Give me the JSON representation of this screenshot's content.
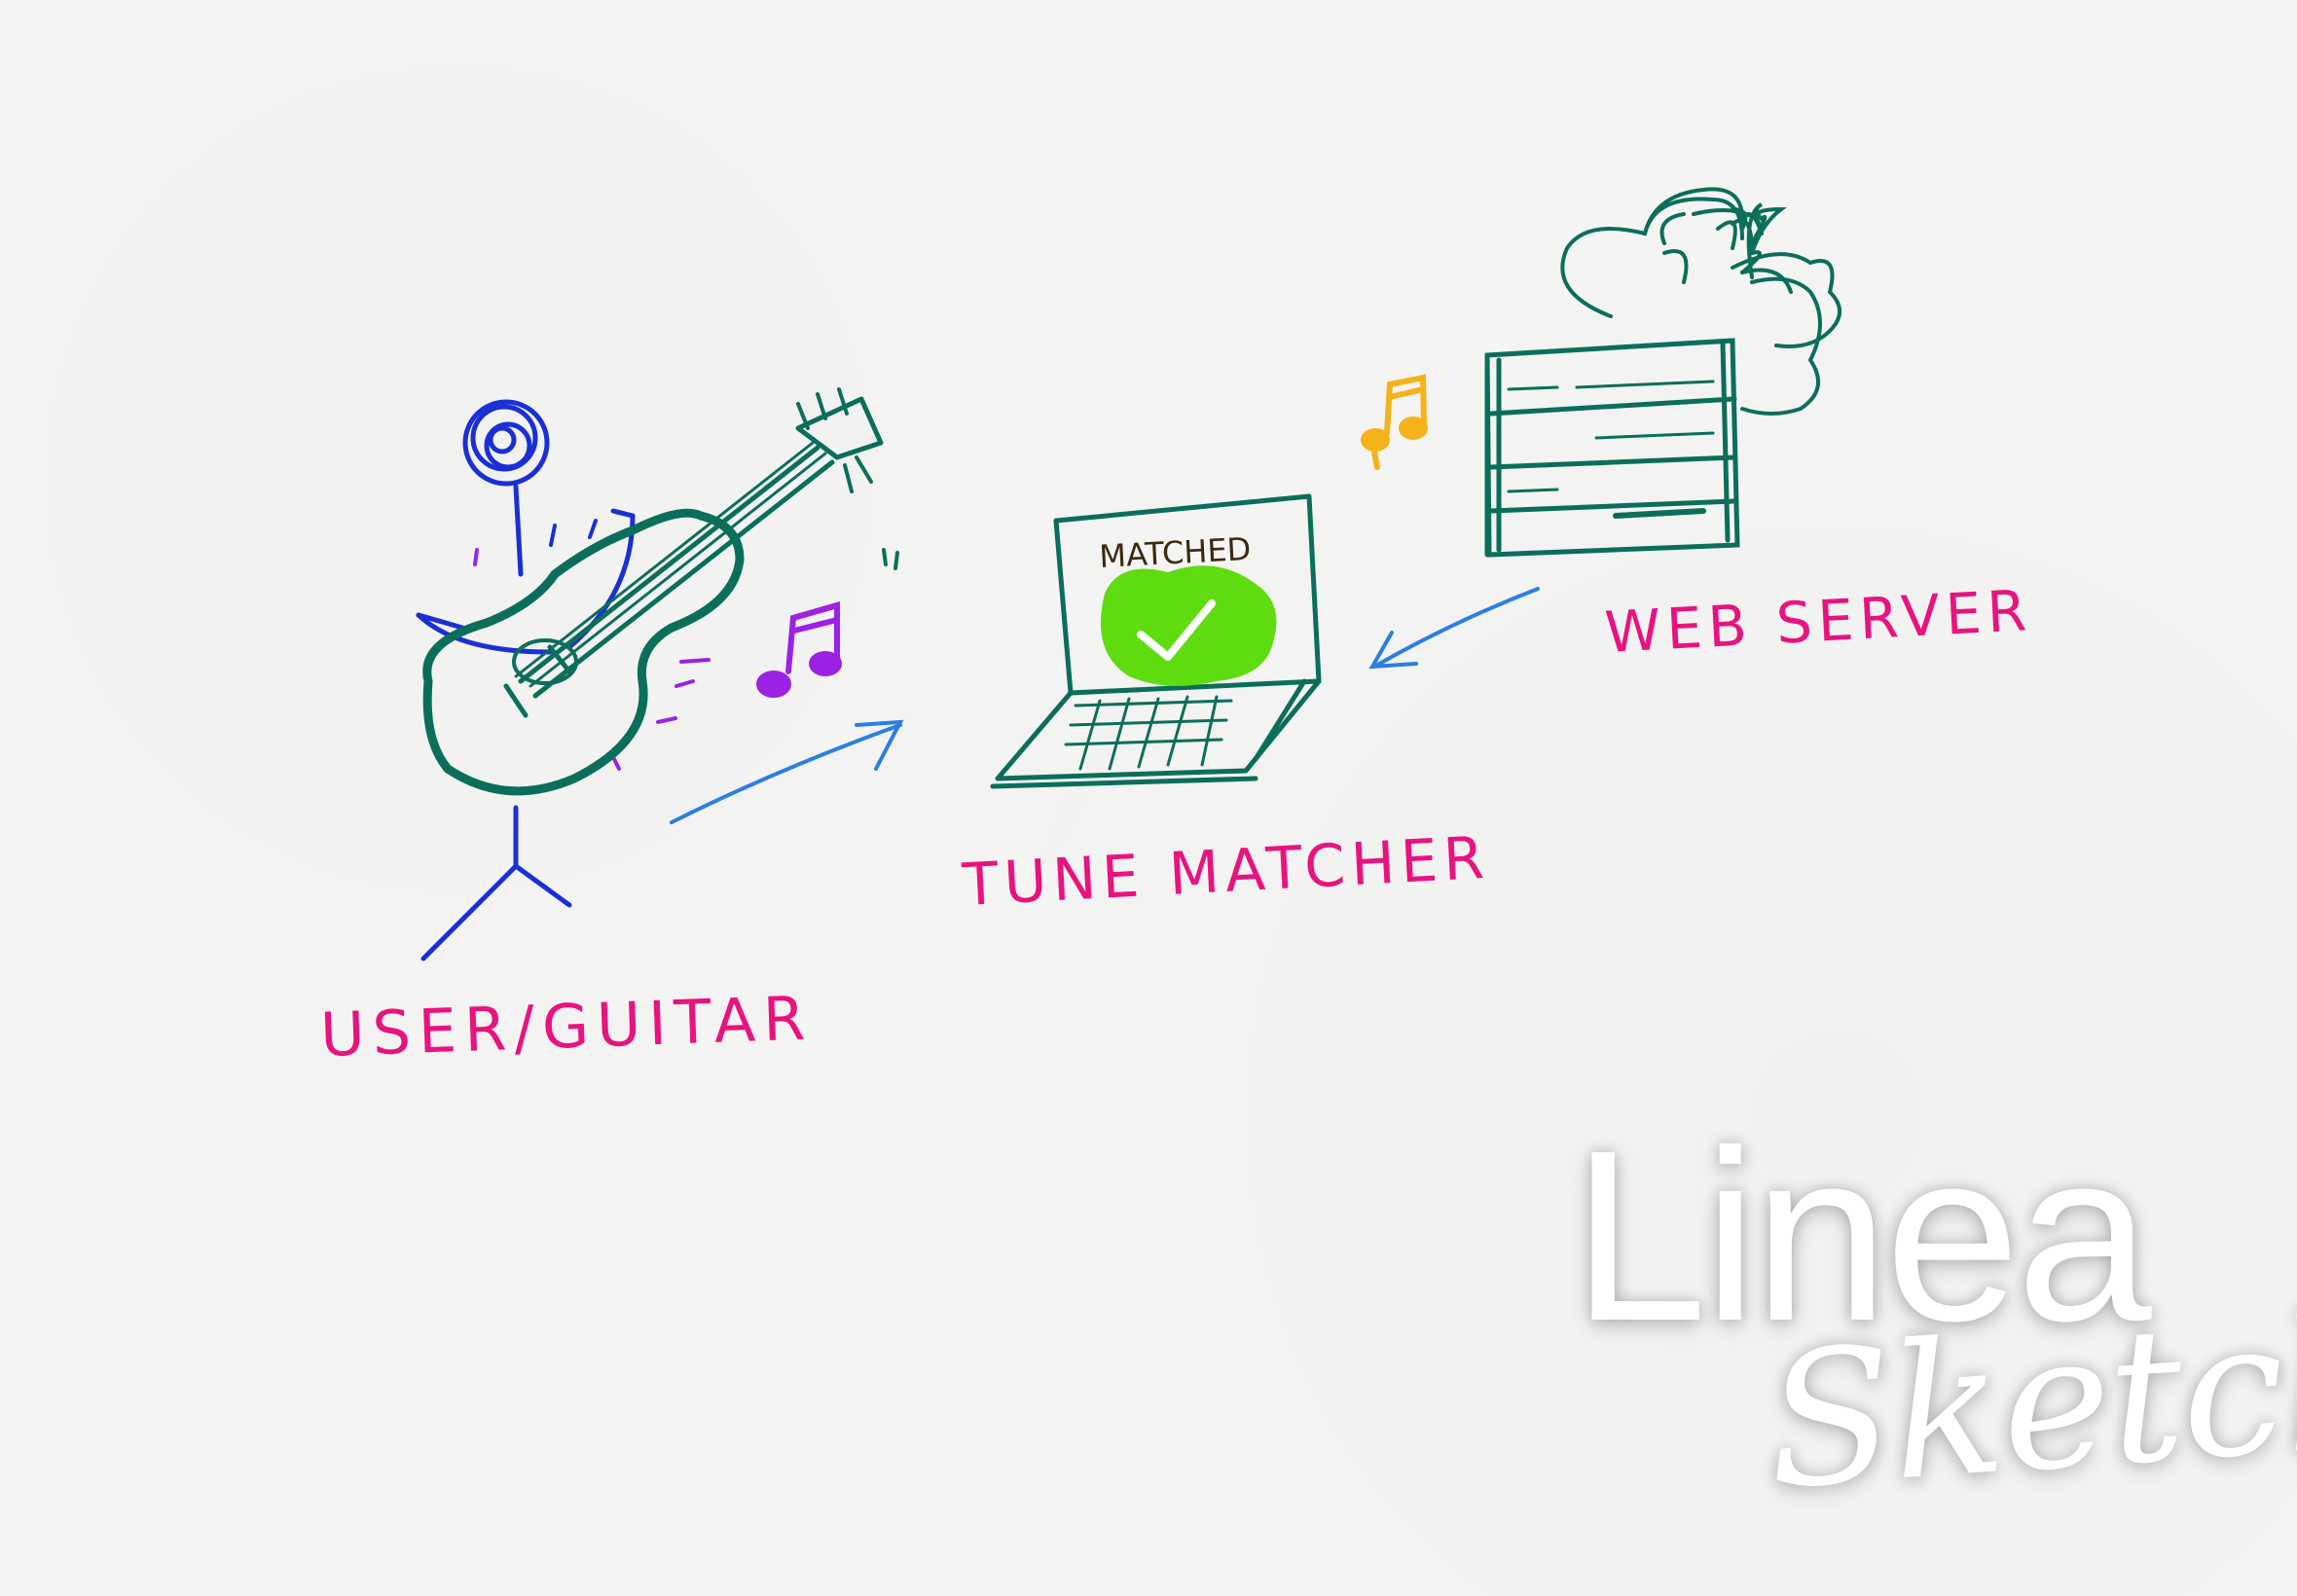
{
  "diagram": {
    "labels": {
      "user": "USER/GUITAR",
      "matcher": "TUNE MATCHER",
      "server": "WEB SERVER",
      "screen": "MATCHED"
    },
    "colors": {
      "label": "#e8137e",
      "stick_figure": "#1a2fd6",
      "device_outline": "#0b6e5a",
      "arrow": "#2a7fe0",
      "note_purple": "#9b22e3",
      "note_orange": "#f6b21a",
      "match_fill": "#5fdc10",
      "screen_text": "#3b2a10"
    },
    "icons": [
      "stick-figure-icon",
      "guitar-icon",
      "music-note-icon",
      "laptop-icon",
      "checkmark-icon",
      "server-icon",
      "cloud-icon",
      "arrow-icon"
    ]
  },
  "logo": {
    "line1": "Linea",
    "line2": "Sketch"
  }
}
